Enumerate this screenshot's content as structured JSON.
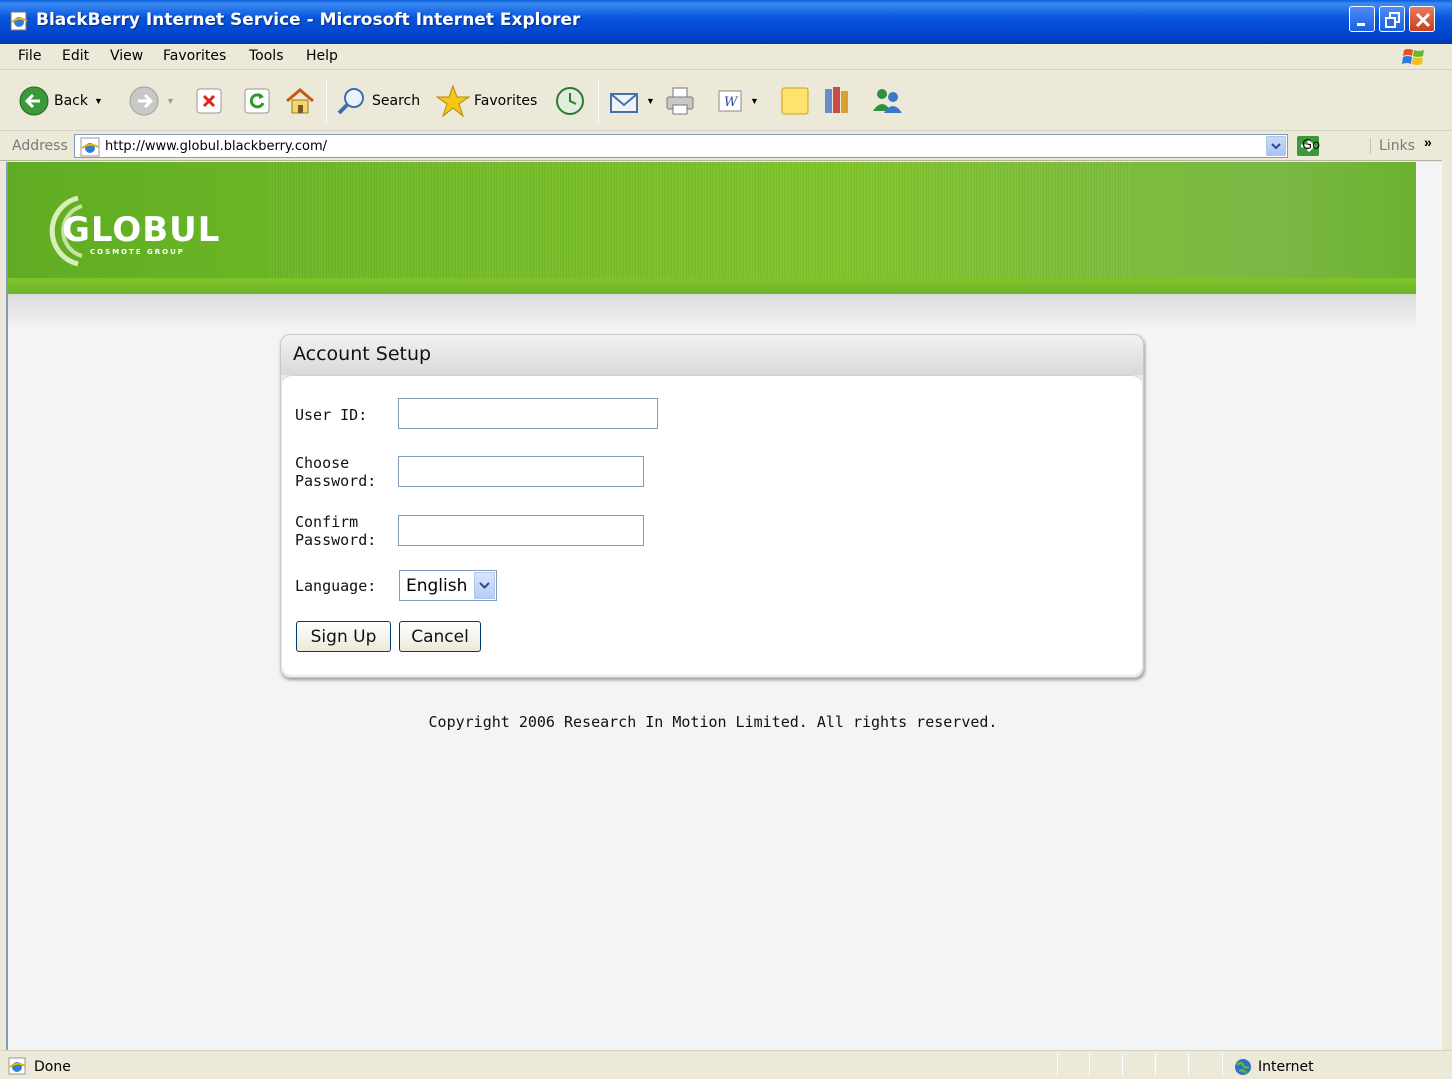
{
  "window": {
    "title": "BlackBerry Internet Service - Microsoft Internet Explorer"
  },
  "menu": [
    "File",
    "Edit",
    "View",
    "Favorites",
    "Tools",
    "Help"
  ],
  "toolbar": {
    "back_label": "Back",
    "search_label": "Search",
    "favorites_label": "Favorites"
  },
  "address": {
    "label": "Address",
    "url": "http://www.globul.blackberry.com/",
    "go_label": "Go",
    "links_label": "Links"
  },
  "banner": {
    "brand": "GLOBUL",
    "tagline": "COSMOTE GROUP",
    "colors": {
      "green": "#74bb26"
    }
  },
  "form": {
    "heading": "Account Setup",
    "user_id_label": "User ID:",
    "user_id_value": "",
    "choose_password_label_1": "Choose",
    "choose_password_label_2": "Password:",
    "choose_password_value": "",
    "confirm_password_label_1": "Confirm",
    "confirm_password_label_2": "Password:",
    "confirm_password_value": "",
    "language_label": "Language:",
    "language_value": "English",
    "sign_up_label": "Sign Up",
    "cancel_label": "Cancel"
  },
  "footer": {
    "copyright": "Copyright 2006 Research In Motion Limited. All rights reserved."
  },
  "status": {
    "text": "Done",
    "zone": "Internet"
  }
}
